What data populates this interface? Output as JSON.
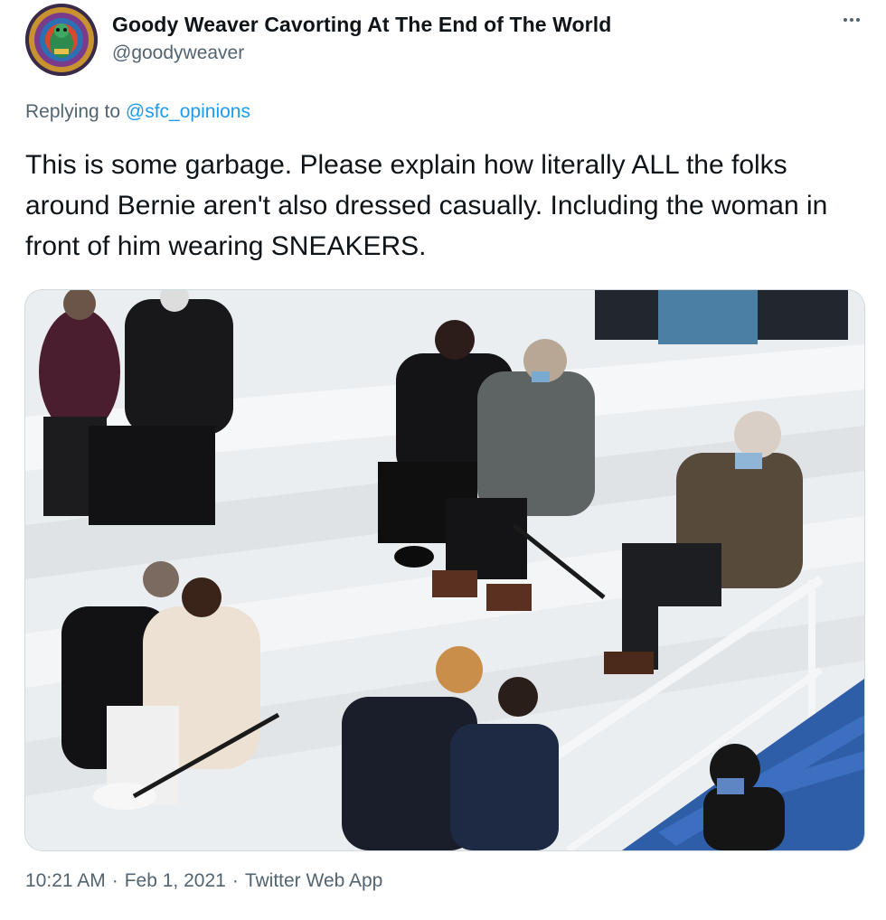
{
  "author": {
    "display_name": "Goody Weaver Cavorting At The End of The World",
    "handle": "@goodyweaver",
    "avatar_icon": "avatar-image"
  },
  "more_icon": "more-options-icon",
  "reply": {
    "prefix": "Replying to",
    "mention": "@sfc_opinions"
  },
  "tweet": {
    "text": "This is some garbage. Please explain how literally ALL the folks around Bernie aren't also dressed casually. Including the woman in front of him wearing SNEAKERS."
  },
  "media": {
    "type": "photo"
  },
  "meta": {
    "time": "10:21 AM",
    "date": "Feb 1, 2021",
    "source": "Twitter Web App",
    "separator": "·"
  },
  "colors": {
    "text": "#0f1419",
    "secondary": "#536471",
    "link": "#1d9bf0",
    "border": "#cfd9de"
  }
}
